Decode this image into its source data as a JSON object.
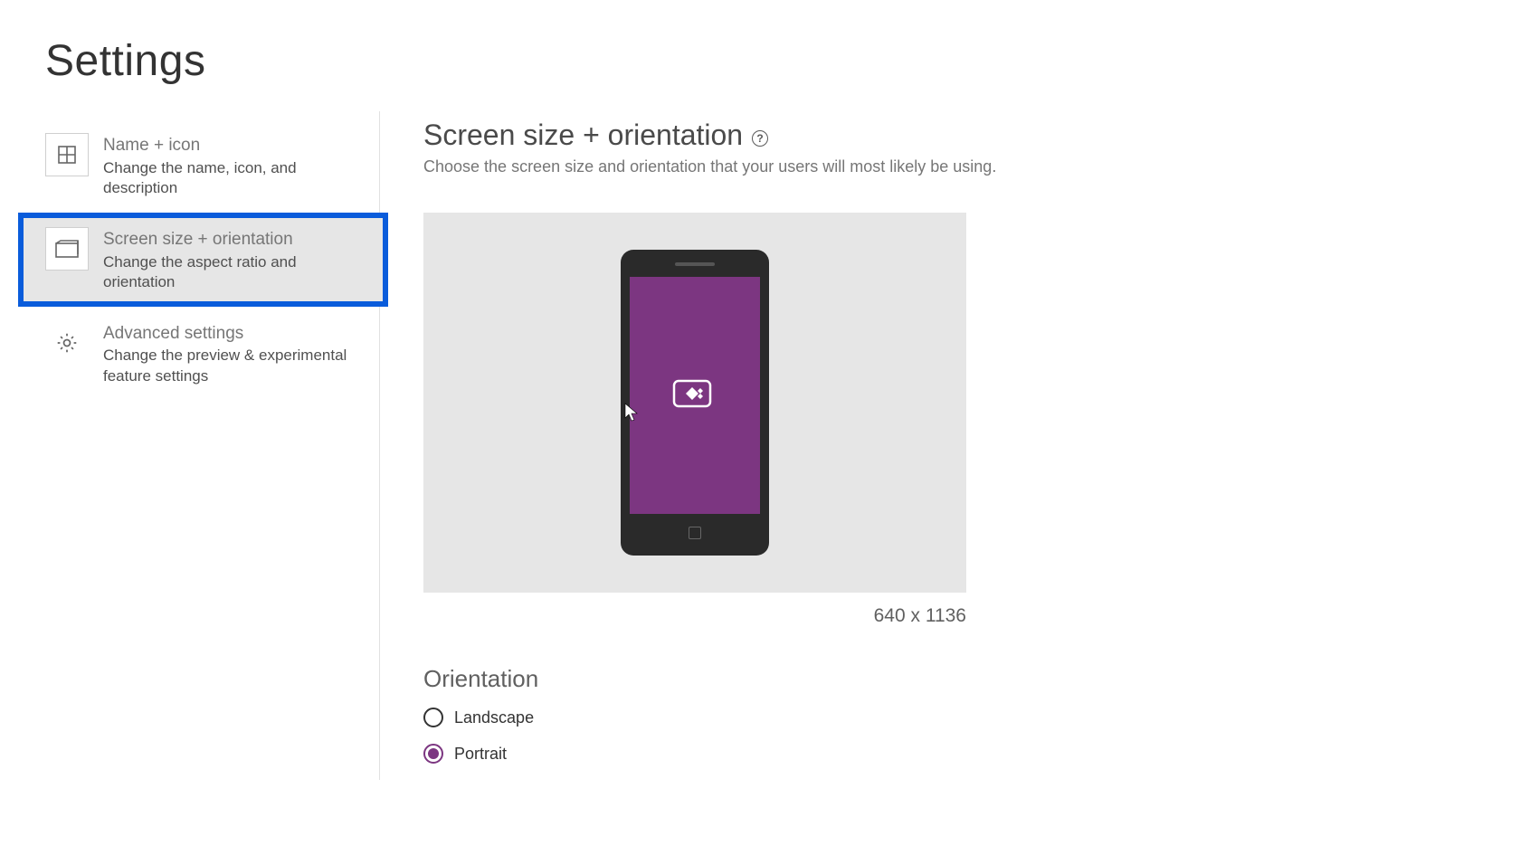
{
  "pageTitle": "Settings",
  "sidebar": {
    "items": [
      {
        "title": "Name + icon",
        "desc": "Change the name, icon, and description"
      },
      {
        "title": "Screen size + orientation",
        "desc": "Change the aspect ratio and orientation"
      },
      {
        "title": "Advanced settings",
        "desc": "Change the preview & experimental feature settings"
      }
    ]
  },
  "main": {
    "sectionTitle": "Screen size + orientation",
    "sectionDesc": "Choose the screen size and orientation that your users will most likely be using.",
    "dimensions": "640 x 1136",
    "orientationTitle": "Orientation",
    "options": {
      "landscape": "Landscape",
      "portrait": "Portrait"
    }
  },
  "helpGlyph": "?",
  "colors": {
    "accentPurple": "#7c3681",
    "highlightBlue": "#0a5cdb"
  }
}
